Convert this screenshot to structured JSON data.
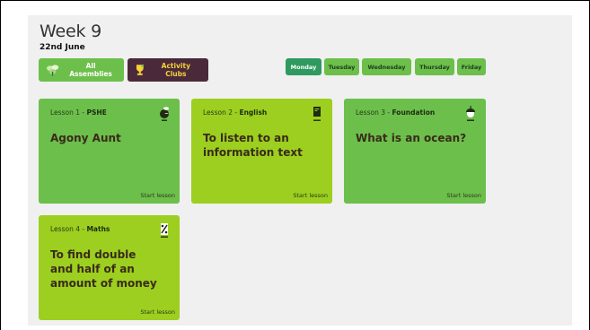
{
  "header": {
    "title": "Week 9",
    "date": "22nd June"
  },
  "buttons": {
    "assemblies": "All Assemblies",
    "clubs": "Activity Clubs"
  },
  "days": [
    "Monday",
    "Tuesday",
    "Wednesday",
    "Thursday",
    "Friday"
  ],
  "active_day": "Monday",
  "lessons": [
    {
      "number": "Lesson 1",
      "subject": "PSHE",
      "title": "Agony Aunt",
      "action": "Start lesson",
      "icon": "apple-icon"
    },
    {
      "number": "Lesson 2",
      "subject": "English",
      "title": "To listen to an information text",
      "action": "Start lesson",
      "icon": "book-icon"
    },
    {
      "number": "Lesson 3",
      "subject": "Foundation",
      "title": "What is an ocean?",
      "action": "Start lesson",
      "icon": "acorn-icon"
    },
    {
      "number": "Lesson 4",
      "subject": "Maths",
      "title": "To find double and half of an amount of money",
      "action": "Start lesson",
      "icon": "percent-icon"
    }
  ],
  "colors": {
    "green": "#6cbf4b",
    "lime": "#9ccf1f",
    "active_tab": "#2f9a5f",
    "clubs_bg": "#4a2a3a",
    "clubs_text": "#f6d23a"
  }
}
